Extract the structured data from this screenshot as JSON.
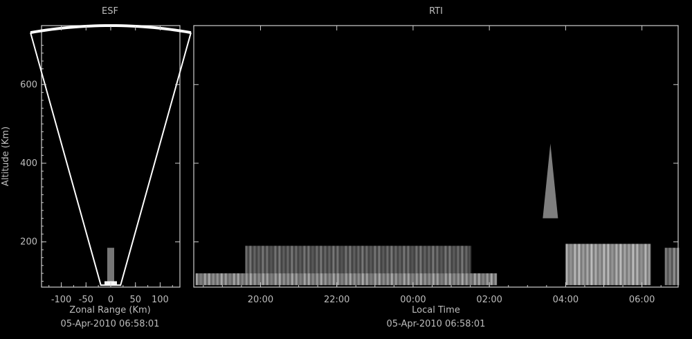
{
  "chart_data": [
    {
      "type": "heatmap",
      "title": "ESF",
      "xlabel": "Zonal Range (Km)",
      "ylabel": "Altitude (Km)",
      "subtitle": "05-Apr-2010 06:58:01",
      "xlim": [
        -140,
        140
      ],
      "ylim": [
        85,
        750
      ],
      "x_ticks": [
        -100,
        -50,
        0,
        50,
        100
      ],
      "x_tick_labels": [
        "-100",
        "-50",
        "0",
        "50",
        "100"
      ],
      "y_ticks": [
        200,
        400,
        600
      ],
      "y_tick_labels": [
        "200",
        "400",
        "600"
      ],
      "fan": {
        "beam_half_angle_deg": 12.5,
        "max_range_km": 750,
        "min_alt_km": 90
      },
      "echo_regions": [
        {
          "name": "E-region echo",
          "zonal_center_km": 0,
          "alt_low_km": 90,
          "alt_high_km": 185,
          "intensity": 0.7
        }
      ]
    },
    {
      "type": "heatmap",
      "title": "RTI",
      "xlabel": "Local Time",
      "subtitle": "05-Apr-2010 06:58:01",
      "x_hours_start": 18.25,
      "x_hours_end": 30.95,
      "ylim": [
        85,
        750
      ],
      "x_ticks_hours": [
        20,
        22,
        24,
        26,
        28,
        30
      ],
      "x_tick_labels": [
        "20:00",
        "22:00",
        "00:00",
        "02:00",
        "04:00",
        "06:00"
      ],
      "y_ticks": [
        200,
        400,
        600
      ],
      "echo_regions": [
        {
          "name": "low E-layer band",
          "t_start_h": 18.3,
          "t_end_h": 26.2,
          "alt_low_km": 90,
          "alt_high_km": 120,
          "intensity": 0.85
        },
        {
          "name": "evening echo block",
          "t_start_h": 19.6,
          "t_end_h": 25.5,
          "alt_low_km": 120,
          "alt_high_km": 190,
          "intensity": 0.55
        },
        {
          "name": "pre-dawn echo block",
          "t_start_h": 28.0,
          "t_end_h": 30.2,
          "alt_low_km": 90,
          "alt_high_km": 195,
          "intensity": 1.0
        },
        {
          "name": "plume",
          "t_start_h": 27.4,
          "t_end_h": 27.8,
          "alt_low_km": 260,
          "alt_high_km": 450,
          "intensity": 0.8
        },
        {
          "name": "dawn echo",
          "t_start_h": 30.6,
          "t_end_h": 30.95,
          "alt_low_km": 90,
          "alt_high_km": 185,
          "intensity": 0.7
        }
      ]
    }
  ],
  "colors": {
    "background": "#000000",
    "axis": "#cfcfcf",
    "text": "#bdbdbd",
    "echo": "#e0e0e0"
  }
}
